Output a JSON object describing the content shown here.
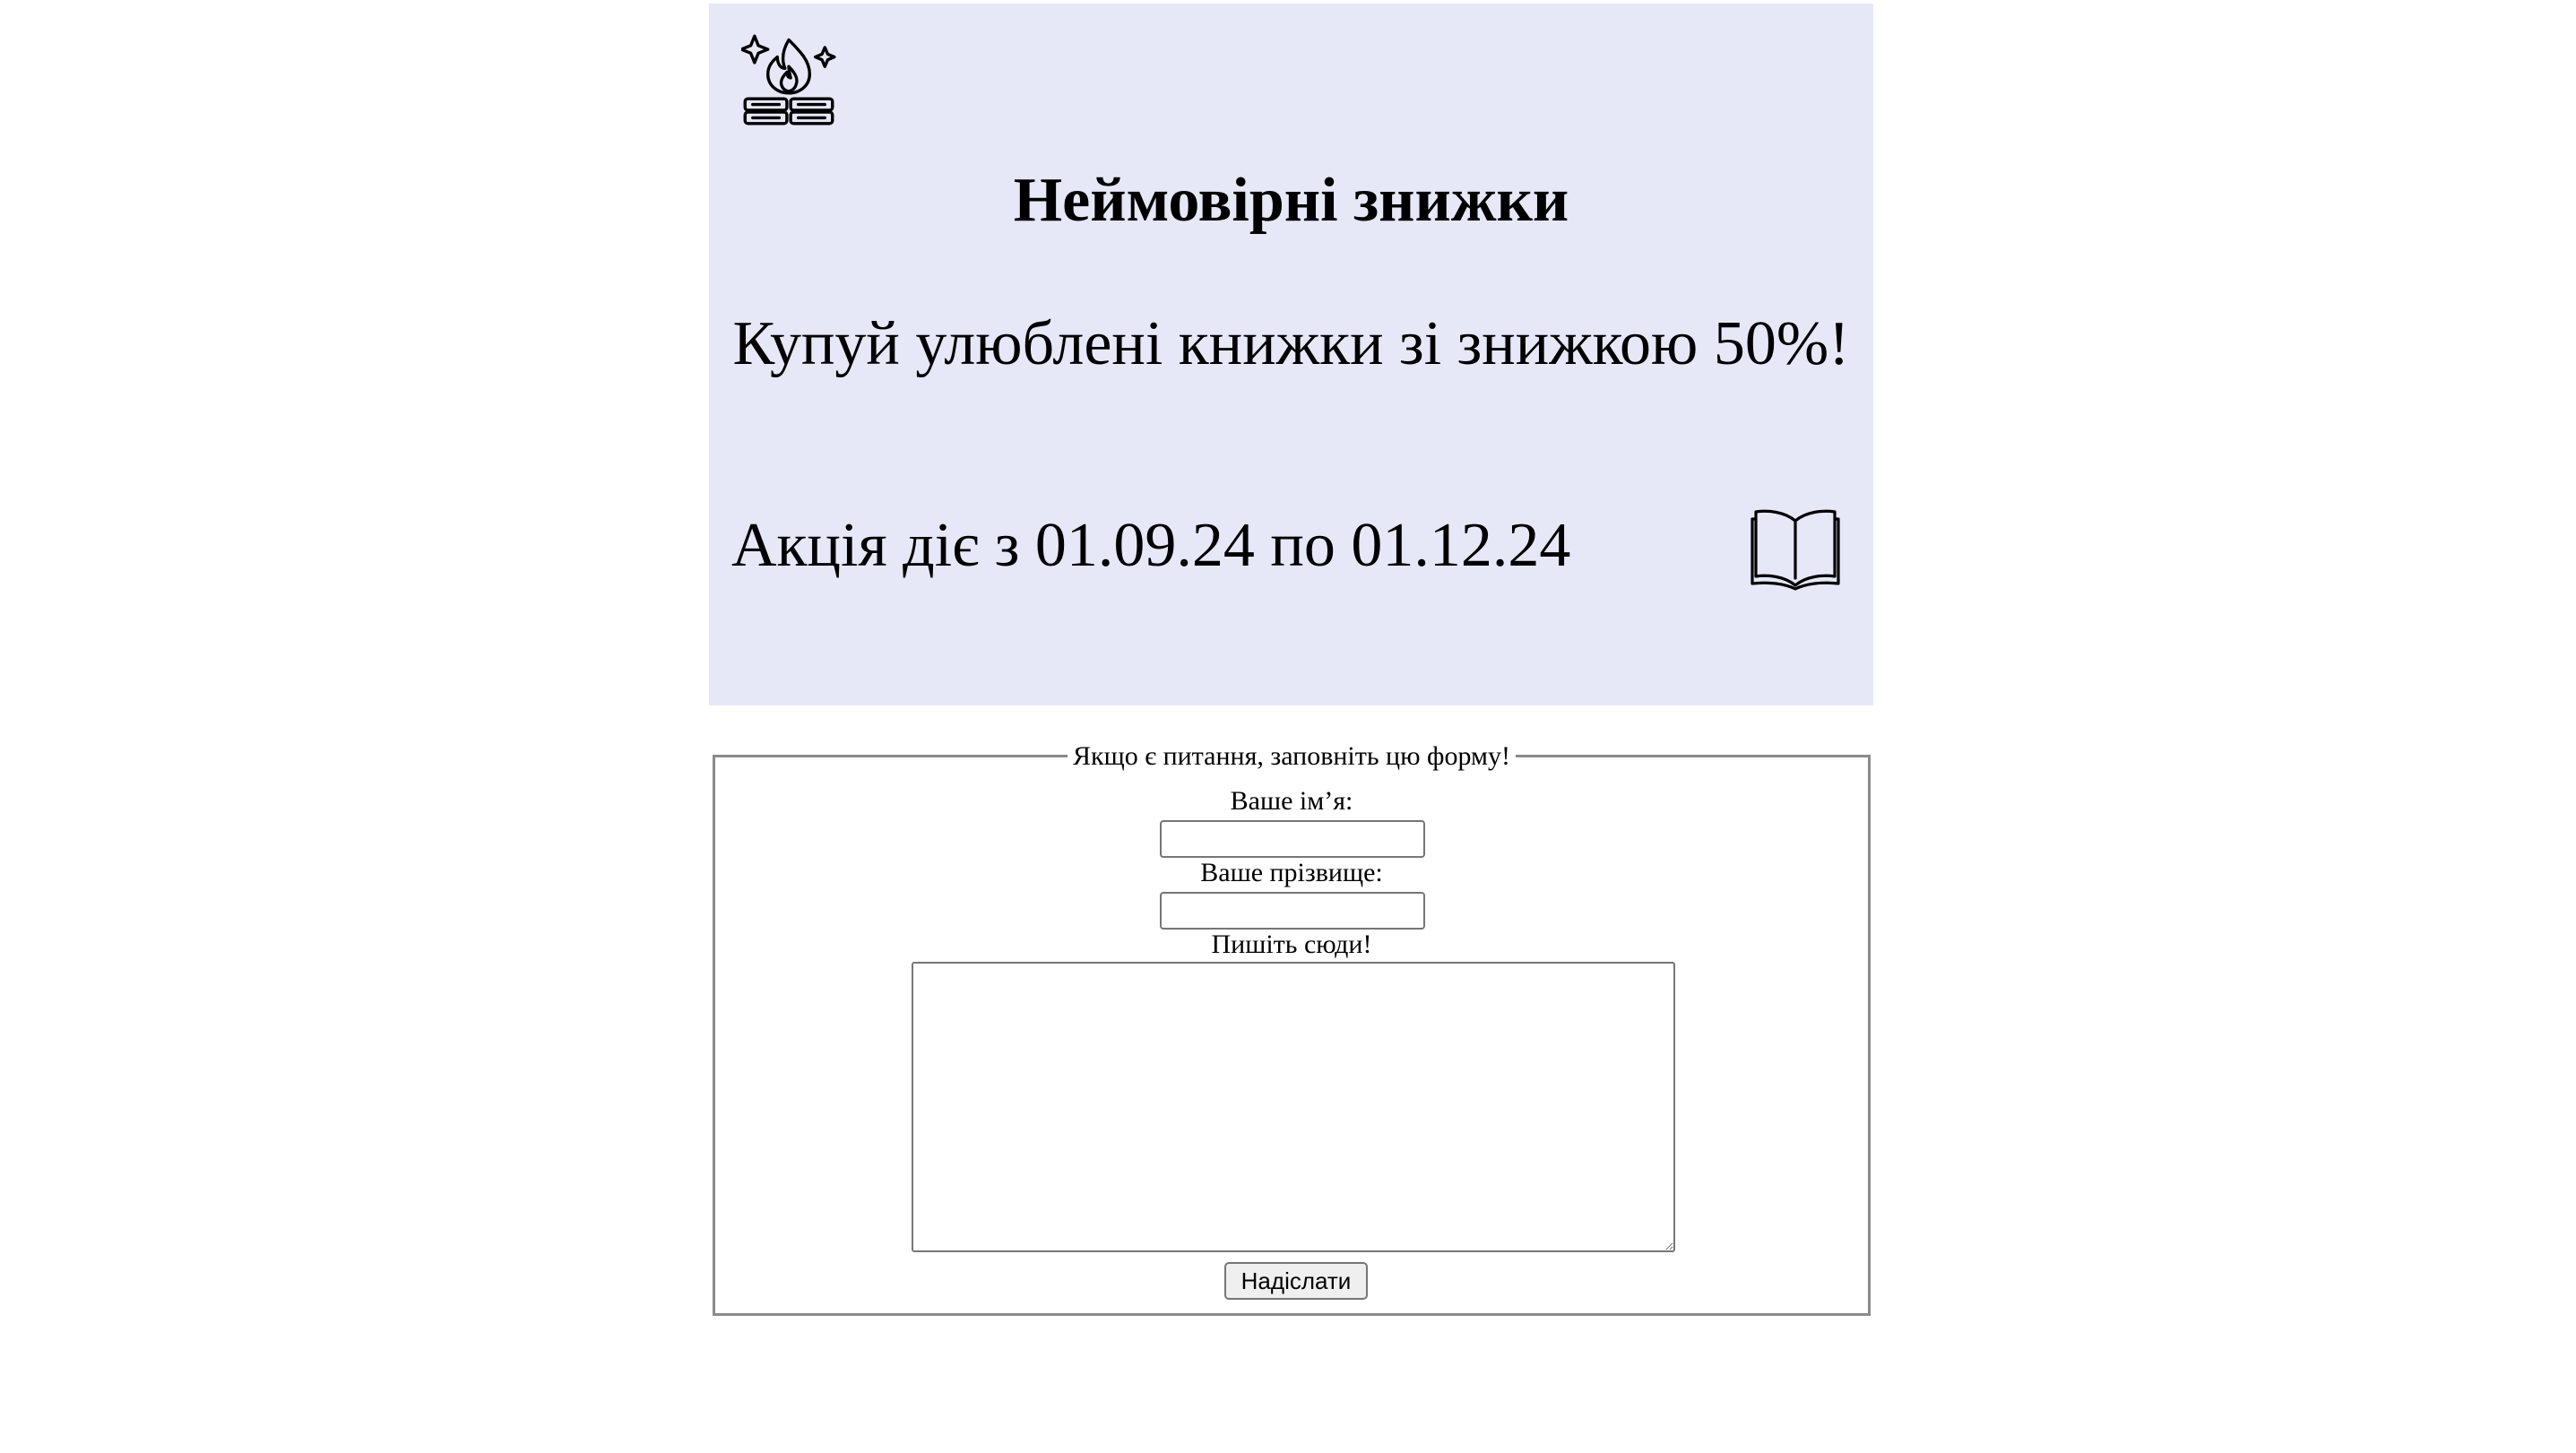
{
  "banner": {
    "title": "Неймовірні знижки",
    "subtitle": "Купуй улюблені книжки зі знижкою 50%!",
    "promo_dates": "Акція діє з 01.09.24 по 01.12.24",
    "logo_icon": "burning-book-sparkles-icon",
    "book_icon": "open-book-icon",
    "background_color": "#e6e8f8"
  },
  "form": {
    "legend": "Якщо є питання, заповніть цю форму!",
    "first_name_label": "Ваше ім’я:",
    "first_name_value": "",
    "last_name_label": "Ваше прізвище:",
    "last_name_value": "",
    "message_label": "Пишіть сюди!",
    "message_value": "",
    "submit_label": "Надіслати"
  }
}
